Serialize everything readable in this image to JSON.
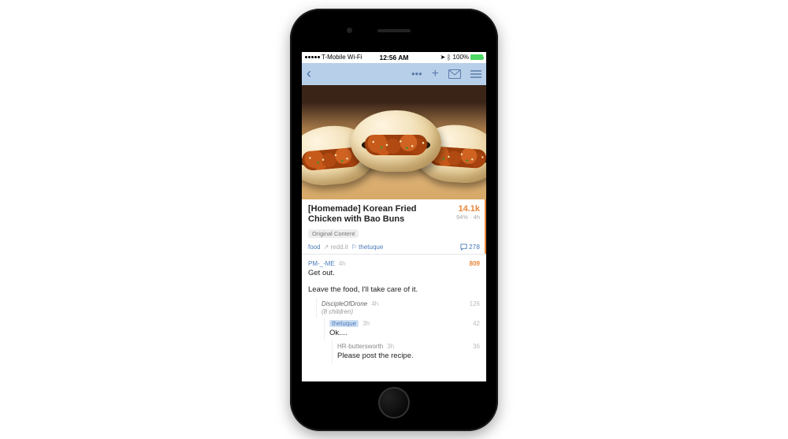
{
  "status": {
    "carrier": "T-Mobile Wi-Fi",
    "time": "12:56 AM",
    "battery_pct": "100%"
  },
  "post": {
    "title": "[Homemade] Korean Fried Chicken with Bao Buns",
    "score": "14.1k",
    "score_sub": "94% · 4h",
    "tag": "Original Content",
    "subreddit": "food",
    "via": "redd.it",
    "author": "thetuque",
    "comment_count": "278"
  },
  "comments": [
    {
      "user": "PM-_-ME",
      "time": "4h",
      "score": "809",
      "hot": true,
      "body_lines": [
        "Get out.",
        "Leave the food, I'll take care of it."
      ]
    },
    {
      "user": "DiscipleOfDrone",
      "time": "4h",
      "score": "126",
      "children": "(8 children)"
    },
    {
      "user": "thetuque",
      "time": "3h",
      "score": "42",
      "op": true,
      "body_lines": [
        "Ok...."
      ]
    },
    {
      "user": "HR-buttersworth",
      "time": "3h",
      "score": "36",
      "body_lines": [
        "Please post the recipe."
      ]
    }
  ]
}
